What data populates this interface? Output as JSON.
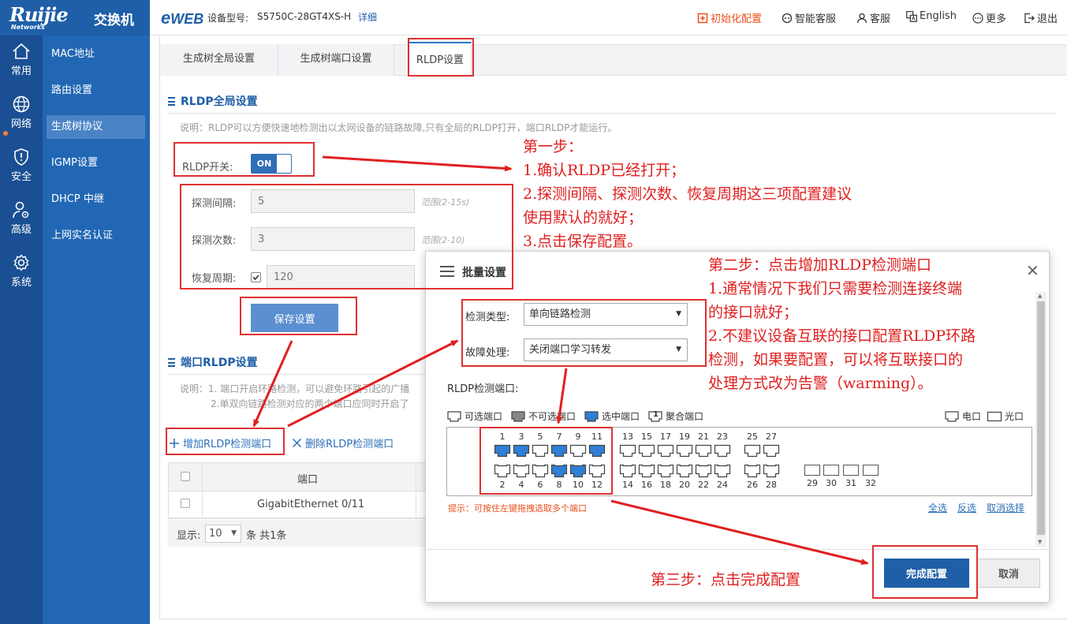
{
  "header": {
    "brand": "Ruijie",
    "brand_sub": "Networks",
    "product": "交换机",
    "eweb_e": "e",
    "eweb_rest": "WEB",
    "model_label": "设备型号:",
    "model_value": "S5750C-28GT4XS-H",
    "detail": "详细",
    "init_config": "初始化配置",
    "smart_service": "智能客服",
    "service": "客服",
    "language": "English",
    "more": "更多",
    "exit": "退出",
    "accent_color": "#e8501c"
  },
  "rail": {
    "items": [
      {
        "label": "常用",
        "icon": "home-icon"
      },
      {
        "label": "网络",
        "icon": "globe-icon"
      },
      {
        "label": "安全",
        "icon": "shield-icon"
      },
      {
        "label": "高级",
        "icon": "user-gear-icon"
      },
      {
        "label": "系统",
        "icon": "gear-icon"
      }
    ]
  },
  "submenu": {
    "items": [
      "MAC地址",
      "路由设置",
      "生成树协议",
      "IGMP设置",
      "DHCP 中继",
      "上网实名认证"
    ],
    "active": "生成树协议"
  },
  "tabs": [
    "生成树全局设置",
    "生成树端口设置",
    "RLDP设置"
  ],
  "global": {
    "title": "RLDP全局设置",
    "desc": "说明：RLDP可以方便快速地检测出以太网设备的链路故障,只有全局的RLDP打开，端口RLDP才能运行。",
    "switch_label": "RLDP开关:",
    "switch_state": "ON",
    "interval_label": "探测间隔:",
    "interval_value": "5",
    "interval_range": "范围(2-15s)",
    "count_label": "探测次数:",
    "count_value": "3",
    "count_range": "范围(2-10)",
    "recover_label": "恢复周期:",
    "recover_value": "120",
    "save": "保存设置"
  },
  "port": {
    "title": "端口RLDP设置",
    "desc_line1": "说明：1. 端口开启环路检测，可以避免环路引起的广播",
    "desc_line2": "2.单双向链路检测对应的两个端口应同时开启了",
    "add": "增加RLDP检测端口",
    "delete": "删除RLDP检测端口",
    "col_port": "端口",
    "rows": [
      "GigabitEthernet 0/11"
    ],
    "pager_show": "显示:",
    "pager_size": "10",
    "pager_total": "条 共1条"
  },
  "modal": {
    "title": "批量设置",
    "detect_type_label": "检测类型:",
    "detect_type_value": "单向链路检测",
    "fault_label": "故障处理:",
    "fault_value": "关闭端口学习转发",
    "ports_label": "RLDP检测端口:",
    "legend": {
      "available": "可选端口",
      "unavailable": "不可选端口",
      "selected": "选中端口",
      "aggregate": "聚合端口",
      "aggregate_badge": "1",
      "copper": "电口",
      "fiber": "光口"
    },
    "ports_top": [
      "1",
      "3",
      "5",
      "7",
      "9",
      "11",
      "13",
      "15",
      "17",
      "19",
      "21",
      "23",
      "25",
      "27"
    ],
    "ports_bottom": [
      "2",
      "4",
      "6",
      "8",
      "10",
      "12",
      "14",
      "16",
      "18",
      "20",
      "22",
      "24",
      "26",
      "28"
    ],
    "fiber_ports": [
      "29",
      "30",
      "31",
      "32"
    ],
    "selected_ports": [
      "1",
      "3",
      "7",
      "11",
      "8",
      "10"
    ],
    "tip": "提示：可按住左键拖拽选取多个端口",
    "select_all": "全选",
    "invert": "反选",
    "clear": "取消选择",
    "finish": "完成配置",
    "cancel": "取消",
    "selected_color": "#2f7fd6"
  },
  "annotations": {
    "step1": [
      "第一步：",
      "1.确认RLDP已经打开；",
      "2.探测间隔、探测次数、恢复周期这三项配置建议",
      "使用默认的就好；",
      "3.点击保存配置。"
    ],
    "step2": [
      "第二步：点击增加RLDP检测端口",
      "1.通常情况下我们只需要检测连接终端",
      "的接口就好；",
      "2.不建议设备互联的接口配置RLDP环路",
      "检测，如果要配置，可以将互联接口的",
      "处理方式改为告警（warming）。"
    ],
    "step3": "第三步：点击完成配置",
    "color": "#e02020"
  }
}
